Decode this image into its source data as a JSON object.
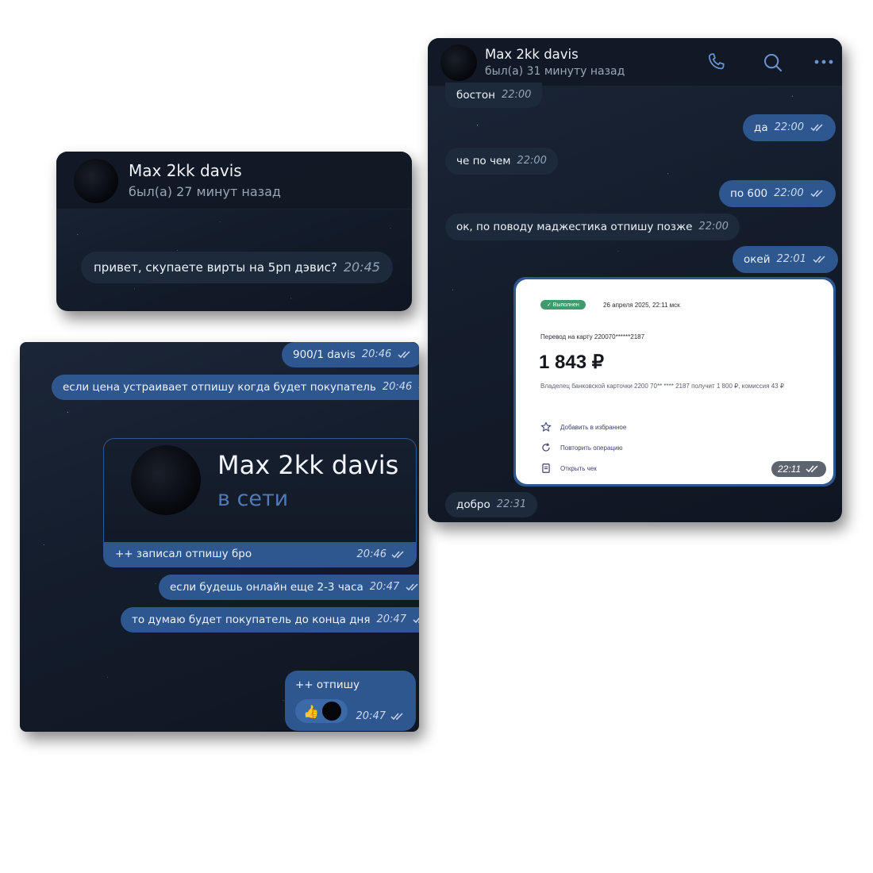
{
  "colors": {
    "bubble_out": "#2e568f",
    "bubble_in": "#1d2a3c",
    "status_online": "#4f79b8",
    "receipt_badge": "#3f9a6c"
  },
  "panel1": {
    "contact_name": "Max 2kk davis",
    "last_seen": "был(а) 27 минут назад",
    "message": {
      "text": "привет, скупаете вирты на 5рп дэвис?",
      "time": "20:45"
    }
  },
  "panel2": {
    "messages": [
      {
        "text": "900/1 davis",
        "time": "20:46"
      },
      {
        "text": "если цена устраивает отпишу когда будет покупатель",
        "time": "20:46"
      }
    ],
    "forward": {
      "contact_name": "Max 2kk davis",
      "status": "в сети",
      "caption": "++ записал отпишу бро",
      "time": "20:46"
    },
    "messages_after": [
      {
        "text": "если будешь онлайн еще 2-3 часа",
        "time": "20:47"
      },
      {
        "text": "то думаю будет покупатель до конца дня",
        "time": "20:47"
      }
    ],
    "last": {
      "text": "++ отпишу",
      "reaction": "👍",
      "time": "20:47"
    }
  },
  "panel3": {
    "contact_name": "Max 2kk davis",
    "last_seen": "был(а) 31 минуту назад",
    "header_icons": [
      "phone-icon",
      "search-icon",
      "more-icon"
    ],
    "messages": [
      {
        "text": "бостон",
        "time": "22:00",
        "dir": "in"
      },
      {
        "text": "да",
        "time": "22:00",
        "dir": "out"
      },
      {
        "text": "че по чем",
        "time": "22:00",
        "dir": "in"
      },
      {
        "text": "по 600",
        "time": "22:00",
        "dir": "out"
      },
      {
        "text": "ок, по поводу маджестика отпишу позже",
        "time": "22:00",
        "dir": "in"
      },
      {
        "text": "окей",
        "time": "22:01",
        "dir": "out"
      },
      {
        "text": "добро",
        "time": "22:31",
        "dir": "in"
      }
    ],
    "receipt": {
      "status": "✓ Выполнен",
      "date": "26 апреля 2025, 22:11 мск",
      "transfer_label": "Перевод на карту 220070******2187",
      "amount": "1 843 ₽",
      "description": "Владелец банковской карточки 2200 70** **** 2187 получит 1 800 ₽, комиссия 43 ₽",
      "actions": [
        "Добавить в избранное",
        "Повторить операцию",
        "Открыть чек"
      ],
      "time": "22:11"
    }
  }
}
